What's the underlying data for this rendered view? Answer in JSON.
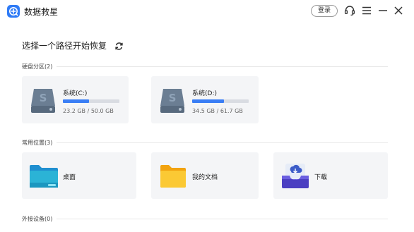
{
  "app": {
    "title": "数据救星",
    "login_label": "登录"
  },
  "icons": {
    "logo": "plus-circle-icon",
    "support": "headset-icon",
    "menu": "hamburger-menu-icon",
    "minimize": "minimize-icon",
    "close": "close-icon",
    "refresh": "refresh-icon"
  },
  "main": {
    "title": "选择一个路径开始恢复"
  },
  "sections": {
    "disks": {
      "label": "硬盘分区(2)",
      "items": [
        {
          "name": "系统(C:)",
          "size": "23.2 GB / 50.0 GB",
          "used_fraction": 0.464
        },
        {
          "name": "系统(D:)",
          "size": "34.5 GB / 61.7 GB",
          "used_fraction": 0.559
        }
      ]
    },
    "common": {
      "label": "常用位置(3)",
      "items": [
        {
          "name": "桌面",
          "icon": "desktop-folder-icon"
        },
        {
          "name": "我的文档",
          "icon": "documents-folder-icon"
        },
        {
          "name": "下载",
          "icon": "download-tray-icon"
        }
      ]
    },
    "external": {
      "label": "外接设备(0)"
    }
  },
  "colors": {
    "accent": "#3a7ef5",
    "card_bg": "#f4f5f7",
    "disk_icon": "#6b7e93"
  }
}
